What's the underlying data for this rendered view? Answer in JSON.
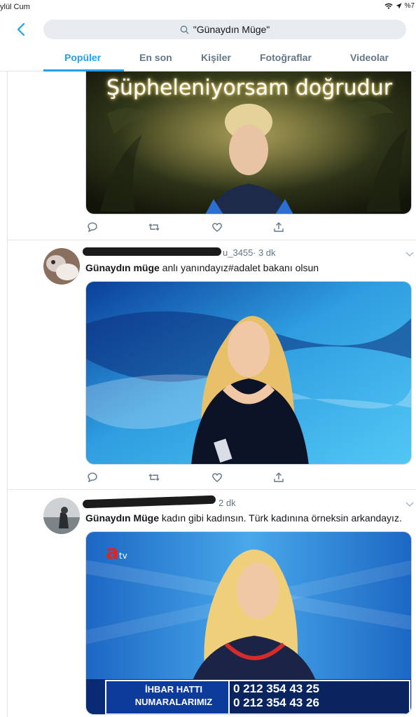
{
  "status_bar": {
    "date_fragment": "ylül Cum",
    "battery": "%7"
  },
  "search": {
    "query": "\"Günaydın Müge\""
  },
  "tabs": [
    {
      "label": "Popüler",
      "active": true
    },
    {
      "label": "En son",
      "active": false
    },
    {
      "label": "Kişiler",
      "active": false
    },
    {
      "label": "Fotoğraflar",
      "active": false
    },
    {
      "label": "Videolar",
      "active": false
    }
  ],
  "tweets": [
    {
      "media_caption": "Şüpheleniyorsam doğrudur"
    },
    {
      "handle_tail": "u_3455",
      "time": "· 3 dk",
      "text_bold": "Günaydın müge",
      "text_rest": " anlı yanındayız#adalet bakanı olsun"
    },
    {
      "time": "2 dk",
      "text_bold": "Günaydın Müge",
      "text_rest": " kadın gibi kadınsın. Türk kadınına örneksin arkandayız.",
      "media_logo": "a",
      "media_logo_suffix": "tv",
      "hotline_label_1": "İHBAR HATTI",
      "hotline_label_2": "NUMARALARIMIZ",
      "hotline_number_1": "0 212 354 43 25",
      "hotline_number_2": "0 212 354 43 26"
    }
  ],
  "colors": {
    "accent": "#1da1f2",
    "muted": "#657786",
    "text": "#14171a"
  },
  "icons": [
    "back-chevron-icon",
    "search-icon",
    "reply-icon",
    "retweet-icon",
    "like-icon",
    "share-icon",
    "caret-down-icon",
    "wifi-icon",
    "location-icon"
  ]
}
